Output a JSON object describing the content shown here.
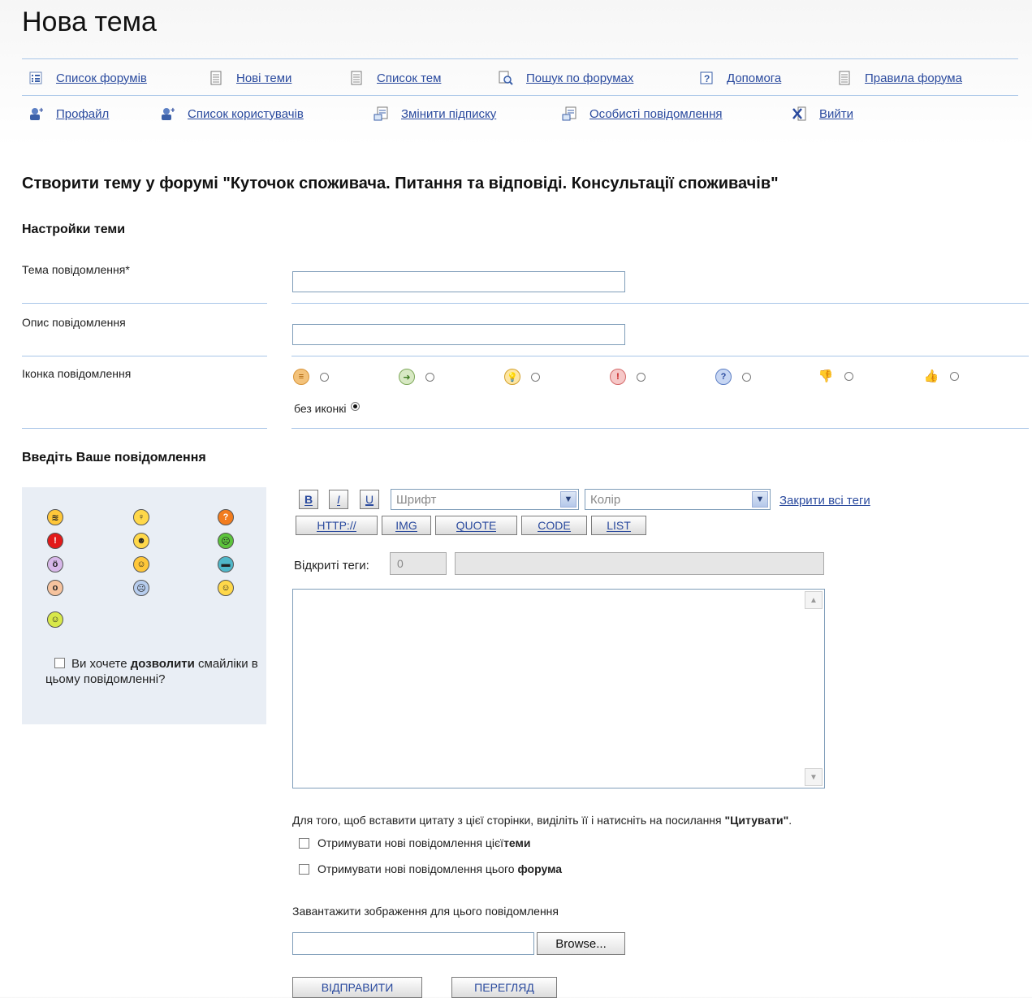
{
  "page": {
    "title": "Нова тема"
  },
  "nav": {
    "row1": [
      {
        "label": "Список форумів",
        "icon": "list-icon"
      },
      {
        "label": "Нові теми",
        "icon": "document-icon"
      },
      {
        "label": "Список тем",
        "icon": "document-icon"
      },
      {
        "label": "Пошук по форумах",
        "icon": "search-icon"
      },
      {
        "label": "Допомога",
        "icon": "help-icon"
      },
      {
        "label": "Правила форума",
        "icon": "document-icon"
      }
    ],
    "row2": [
      {
        "label": "Профайл",
        "icon": "user-icon"
      },
      {
        "label": "Список користувачів",
        "icon": "users-icon"
      },
      {
        "label": "Змінити підписку",
        "icon": "subscription-icon"
      },
      {
        "label": "Особисті повідомлення",
        "icon": "messages-icon"
      },
      {
        "label": "Вийти",
        "icon": "logout-icon"
      }
    ]
  },
  "form": {
    "heading": "Створити тему у форумі \"Куточок споживача. Питання та відповіді. Консультації споживачів\"",
    "settings_heading": "Настройки теми",
    "subject_label": "Тема повідомлення*",
    "subject_value": "",
    "description_label": "Опис повідомлення",
    "description_value": "",
    "icon_label": "Іконка повідомлення",
    "no_icon_label": "без иконкі",
    "message_heading": "Введіть Ваше повідомлення",
    "smilies_question_prefix": "Ви хочете",
    "smilies_question_bold": "дозволити",
    "smilies_question_rest": "смайліки в цьому повідомленні?",
    "smilies_allowed": false
  },
  "toolbar": {
    "bold": "B",
    "italic": "I",
    "underline": "U",
    "font_select": "Шрифт",
    "color_select": "Колір",
    "close_tags_link": "Закрити всі теги",
    "buttons": [
      "HTTP://",
      "IMG",
      "QUOTE",
      "CODE",
      "LIST"
    ],
    "open_tags_label": "Відкриті теги:",
    "open_tags_count": "0"
  },
  "message_body": "",
  "quote_note": {
    "text": "Для того, щоб вставити цитату з цієї сторінки, виділіть її і натисніть на посилання ",
    "bold": "\"Цитувати\"",
    "end": "."
  },
  "notify": {
    "topic_text": "Отримувати нові повідомлення цієї",
    "topic_bold": "теми",
    "forum_text": "Отримувати нові повідомлення цього ",
    "forum_bold": "форума"
  },
  "upload": {
    "label": "Завантажити зображення для цього повідомлення",
    "browse": "Browse..."
  },
  "actions": {
    "submit": "ВІДПРАВИТИ",
    "preview": "ПЕРЕГЛЯД"
  }
}
